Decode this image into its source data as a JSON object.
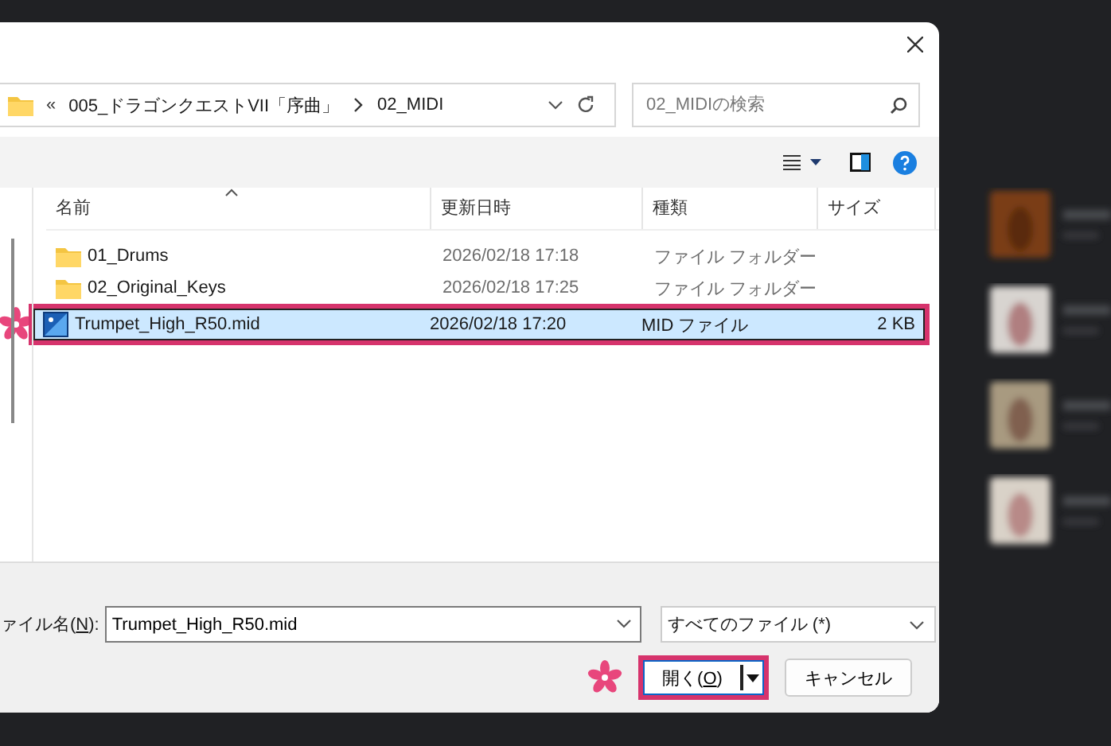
{
  "address": {
    "overflow": "«",
    "path": [
      "005_ドラゴンクエストVII「序曲」",
      "02_MIDI"
    ]
  },
  "search": {
    "placeholder": "02_MIDIの検索"
  },
  "columns": [
    "名前",
    "更新日時",
    "種類",
    "サイズ"
  ],
  "rows": [
    {
      "kind": "folder",
      "name": "01_Drums",
      "modified": "2026/02/18 17:18",
      "type": "ファイル フォルダー",
      "size": "",
      "selected": false
    },
    {
      "kind": "folder",
      "name": "02_Original_Keys",
      "modified": "2026/02/18 17:25",
      "type": "ファイル フォルダー",
      "size": "",
      "selected": false
    },
    {
      "kind": "file",
      "name": "Trumpet_High_R50.mid",
      "modified": "2026/02/18 17:20",
      "type": "MID ファイル",
      "size": "2 KB",
      "selected": true
    }
  ],
  "filename": {
    "label_before": "ァイル名(",
    "access_key": "N",
    "label_after": "):",
    "value": "Trumpet_High_R50.mid"
  },
  "filter": {
    "value": "すべてのファイル (*)"
  },
  "open_button": {
    "label_before": "開く(",
    "access_key": "O",
    "label_after": ")"
  },
  "cancel_button": {
    "label": "キャンセル"
  }
}
